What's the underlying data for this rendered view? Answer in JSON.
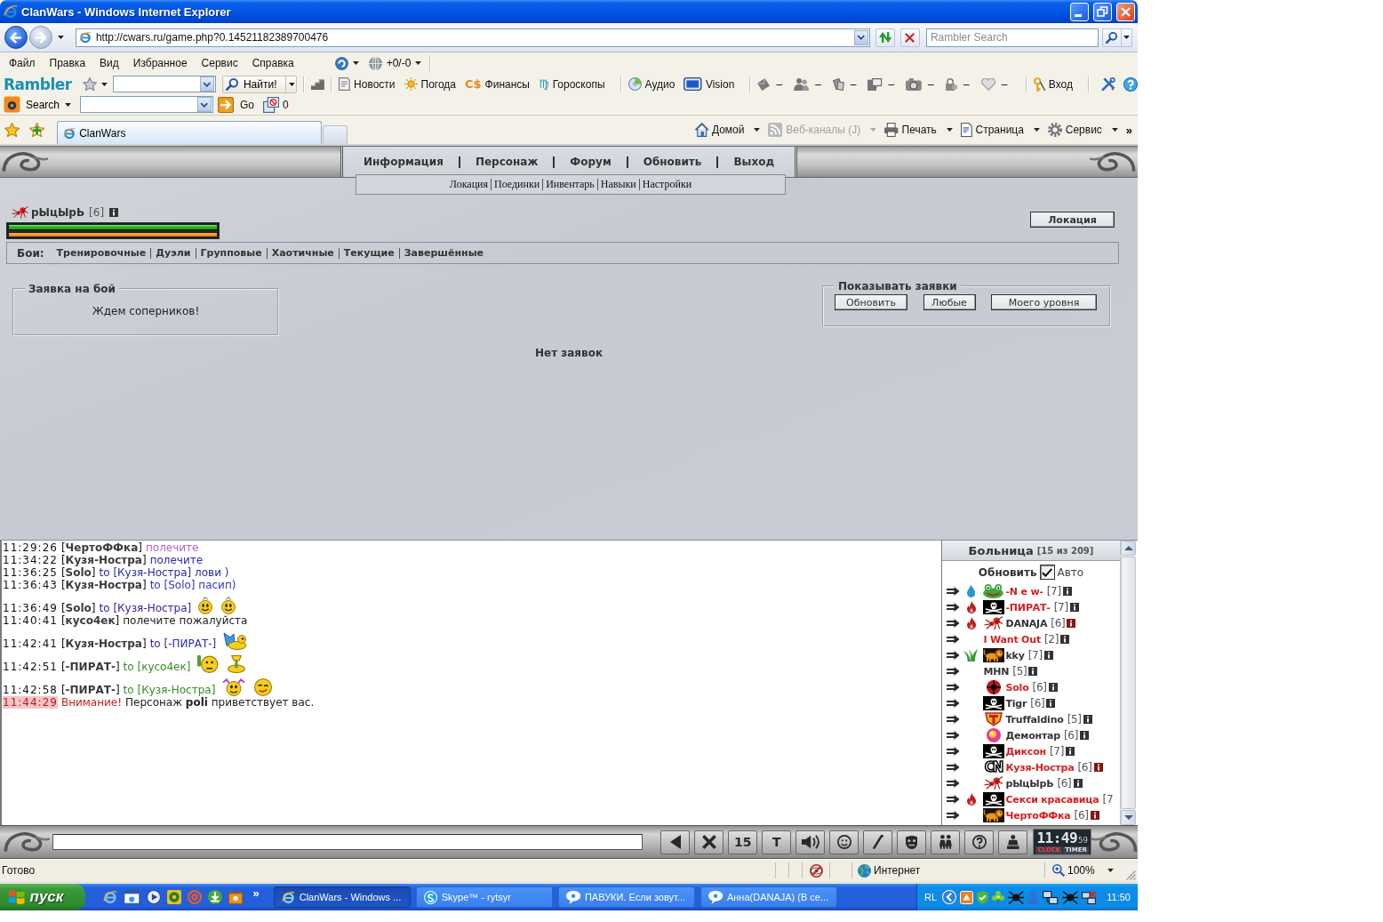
{
  "window": {
    "title": "ClanWars - Windows Internet Explorer"
  },
  "address_bar": {
    "url": "http://cwars.ru/game.php?0.14521182389700476"
  },
  "search_box": {
    "placeholder": "Rambler Search"
  },
  "menu_bar": {
    "items": [
      "Файл",
      "Правка",
      "Вид",
      "Избранное",
      "Сервис",
      "Справка"
    ],
    "counter": "+0/-0"
  },
  "rambler_toolbar": {
    "logo": "Rambler",
    "find_button": "Найти!",
    "link_groups": [
      [
        {
          "kind": "news",
          "label": "Новости"
        },
        {
          "kind": "weather",
          "label": "Погода"
        },
        {
          "symbol": "C$",
          "color": "#e8861a",
          "label": "Финансы"
        },
        {
          "symbol": "♍",
          "color": "#1a98a8",
          "label": "Гороскопы"
        }
      ],
      [
        {
          "kind": "audio",
          "label": "Аудио"
        },
        {
          "kind": "vision",
          "label": "Vision"
        }
      ]
    ],
    "services": [
      {
        "kind": "mail",
        "count": "–"
      },
      {
        "kind": "people",
        "count": "–"
      },
      {
        "kind": "docs",
        "count": "–"
      },
      {
        "kind": "chat",
        "count": "–"
      },
      {
        "kind": "photo",
        "count": "–"
      },
      {
        "kind": "lock",
        "count": "–"
      },
      {
        "kind": "heart",
        "count": "–"
      }
    ],
    "login": "Вход"
  },
  "search_toolbar": {
    "label": "Search",
    "go": "Go",
    "blocked_count": "0"
  },
  "tabs": [
    {
      "label": "ClanWars",
      "selected": true
    }
  ],
  "command_bar": {
    "items": [
      {
        "kind": "home",
        "label": "Домой",
        "disabled": false
      },
      {
        "kind": "feed",
        "label": "Веб-каналы (J)",
        "disabled": true
      },
      {
        "kind": "print",
        "label": "Печать",
        "disabled": false
      },
      {
        "kind": "page",
        "label": "Страница",
        "disabled": false
      },
      {
        "kind": "gear",
        "label": "Сервис",
        "disabled": false
      }
    ],
    "more": "»"
  },
  "game": {
    "nav": [
      "Информация",
      "Персонаж",
      "Форум",
      "Обновить",
      "Выход"
    ],
    "subnav": [
      "Локация",
      "Поединки",
      "Инвентарь",
      "Навыки",
      "Настройки"
    ],
    "player": {
      "name": "рЫцЫрЬ",
      "level": "[6]",
      "health": {
        "level": 1
      },
      "energy": {
        "level": 1
      }
    },
    "location_button": "Локация",
    "battles": {
      "label": "Бои:",
      "links": [
        "Тренировочные",
        "Дуэли",
        "Групповые",
        "Хаотичные",
        "Текущие",
        "Завершённые"
      ]
    },
    "request_panel": {
      "legend": "Заявка на бой",
      "status": "Ждем соперников!"
    },
    "filter_panel": {
      "legend": "Показывать заявки",
      "buttons": [
        "Обновить",
        "Любые",
        "Моего уровня"
      ]
    },
    "empty_text": "Нет заявок"
  },
  "chat": [
    {
      "kind": "message",
      "time": "11:29:26",
      "sender": "[**ЧертоФФка**]",
      "text": "полечите",
      "color": "#b462c4"
    },
    {
      "kind": "message",
      "time": "11:34:22",
      "sender": "[**Кузя-Ностра**]",
      "text": "полечите",
      "color": "#2a2aa8"
    },
    {
      "kind": "message",
      "time": "11:36:25",
      "sender": "[**Solo**]",
      "text": "to [Кузя-Ностра] лови )",
      "color": "#2a2aa8"
    },
    {
      "kind": "message",
      "time": "11:36:43",
      "sender": "[**Кузя-Ностра**]",
      "text": "to [Solo] пасип)",
      "color": "#3434c4"
    },
    {
      "kind": "message",
      "time": "11:36:49",
      "sender": "[**Solo**]",
      "text": "to [Кузя-Ностра]",
      "color": "#2a2aa8",
      "emoticons": [
        {
          "kind": "smile"
        },
        {
          "kind": "smile"
        }
      ]
    },
    {
      "kind": "message",
      "time": "11:40:41",
      "sender": "[**кусо4ек**]",
      "text": "полечите пожалуйста",
      "color": "#222222"
    },
    {
      "kind": "message",
      "time": "11:42:41",
      "sender": "[**Кузя-Ностра**]",
      "text": "to [-ПИРАТ-]",
      "color": "#2a2aa8",
      "emoticons": [
        {
          "kind": "butterfly"
        }
      ]
    },
    {
      "kind": "message",
      "time": "11:42:51",
      "sender": "[**-ПИРАТ-**]",
      "text": "to [кусо4ек]",
      "color": "#3a8a2a",
      "emoticons": [
        {
          "kind": "toast"
        },
        {
          "kind": "cup"
        }
      ]
    },
    {
      "kind": "message",
      "time": "11:42:58",
      "sender": "[**-ПИРАТ-**]",
      "text": "to [Кузя-Ностра]",
      "color": "#3a8a2a",
      "emoticons": [
        {
          "kind": "pigtails"
        },
        {
          "kind": "wink"
        }
      ]
    },
    {
      "kind": "system",
      "time": "11:44:29",
      "alert": "Внимание!",
      "text": "Персонаж **poli** приветствует вас."
    }
  ],
  "hospital": {
    "title": "Больница",
    "count": "[15 из 209]",
    "refresh": "Обновить",
    "auto": {
      "label": "Авто",
      "checked": true
    },
    "patients": [
      {
        "effect": {
          "kind": "drop"
        },
        "emblem": {
          "kind": "frog"
        },
        "name": "-N e w-",
        "color": "#d81e1e",
        "level": "[7]",
        "info": {
          "kind": "plain"
        }
      },
      {
        "effect": {
          "kind": "flame"
        },
        "emblem": {
          "kind": "pirate"
        },
        "name": "-ПИРАТ-",
        "color": "#d81e1e",
        "level": "[7]",
        "info": {
          "kind": "plain"
        }
      },
      {
        "effect": {
          "kind": "flame"
        },
        "emblem": {
          "kind": "spider"
        },
        "name": "DANAJA",
        "color": "#333333",
        "level": "[6]",
        "info": {
          "kind": "alert"
        }
      },
      {
        "name": "I Want Out",
        "color": "#d81e1e",
        "level": "[2]",
        "info": {
          "kind": "plain"
        }
      },
      {
        "effect": {
          "kind": "leaf"
        },
        "emblem": {
          "kind": "lion"
        },
        "name": "kky",
        "color": "#333333",
        "level": "[7]",
        "info": {
          "kind": "plain"
        }
      },
      {
        "name": "MHN",
        "color": "#333333",
        "level": "[5]",
        "info": {
          "kind": "plain"
        }
      },
      {
        "emblem": {
          "kind": "target"
        },
        "name": "Solo",
        "color": "#d81e1e",
        "level": "[6]",
        "info": {
          "kind": "plain"
        }
      },
      {
        "emblem": {
          "kind": "pirate"
        },
        "name": "Tigr",
        "color": "#333333",
        "level": "[6]",
        "info": {
          "kind": "plain"
        }
      },
      {
        "emblem": {
          "kind": "shield"
        },
        "name": "Truffaldino",
        "color": "#333333",
        "level": "[5]",
        "info": {
          "kind": "plain"
        }
      },
      {
        "emblem": {
          "kind": "ball"
        },
        "name": "Демонтар",
        "color": "#333333",
        "level": "[6]",
        "info": {
          "kind": "plain"
        }
      },
      {
        "emblem": {
          "kind": "pirate"
        },
        "name": "Диксон",
        "color": "#d81e1e",
        "level": "[7]",
        "info": {
          "kind": "plain"
        }
      },
      {
        "emblem": {
          "kind": "letters",
          "label": "CN"
        },
        "name": "Кузя-Ностра",
        "color": "#d81e1e",
        "level": "[6]",
        "info": {
          "kind": "alert"
        }
      },
      {
        "emblem": {
          "kind": "spider"
        },
        "name": "рЫцЫрЬ",
        "color": "#333333",
        "level": "[6]",
        "info": {
          "kind": "plain"
        }
      },
      {
        "effect": {
          "kind": "flame"
        },
        "emblem": {
          "kind": "pirate"
        },
        "name": "Секси красавица",
        "color": "#d81e1e",
        "level": "[7"
      },
      {
        "emblem": {
          "kind": "lion"
        },
        "name": "ЧертоФФка",
        "color": "#d81e1e",
        "level": "[6]",
        "info": {
          "kind": "alert"
        }
      }
    ]
  },
  "chat_toolbar": {
    "buttons": [
      {
        "kind": "back"
      },
      {
        "kind": "clear"
      },
      {
        "kind": "label",
        "label": "15"
      },
      {
        "kind": "label",
        "label": "T"
      },
      {
        "kind": "sound"
      },
      {
        "kind": "smiles"
      },
      {
        "kind": "pen"
      },
      {
        "kind": "face"
      },
      {
        "kind": "people"
      },
      {
        "kind": "help"
      },
      {
        "kind": "figure"
      }
    ],
    "clock": {
      "time": "11:49",
      "seconds": "59",
      "modes": [
        {
          "label": "CLOCK",
          "selected": true
        },
        {
          "label": "TIMER",
          "selected": false
        }
      ]
    }
  },
  "status_bar": {
    "text": "Готово",
    "zone": "Интернет",
    "zoom": "100%"
  },
  "taskbar": {
    "start": "пуск",
    "quick_launch": [
      {
        "kind": "browser"
      },
      {
        "kind": "window"
      },
      {
        "kind": "media"
      },
      {
        "kind": "disc"
      },
      {
        "kind": "mail"
      },
      {
        "kind": "torrent"
      },
      {
        "kind": "box"
      }
    ],
    "more": "»",
    "tasks": [
      {
        "kind": "browser",
        "label": "ClanWars - Windows ...",
        "selected": true
      },
      {
        "kind": "skype",
        "label": "Skype™ - rytsyr",
        "selected": false
      },
      {
        "kind": "chat",
        "label": "ПАВУКИ. Если зовут...",
        "selected": false
      },
      {
        "kind": "chat",
        "label": "Анна(DANAJA) (В се...",
        "selected": false
      }
    ],
    "language": "RL",
    "tray": [
      {
        "kind": "app"
      },
      {
        "kind": "shield"
      },
      {
        "kind": "flower"
      },
      {
        "kind": "spider"
      },
      {
        "kind": "person"
      },
      {
        "kind": "network"
      },
      {
        "kind": "spider"
      },
      {
        "kind": "network_off"
      }
    ],
    "clock": "11:50"
  }
}
